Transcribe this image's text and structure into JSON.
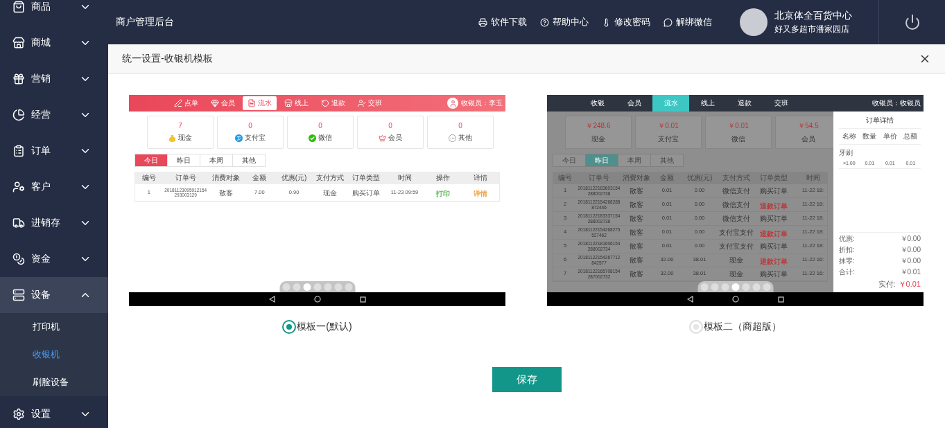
{
  "sidebar": {
    "items": [
      {
        "label": "商品",
        "expanded": false
      },
      {
        "label": "商城",
        "expanded": false
      },
      {
        "label": "营销",
        "expanded": false
      },
      {
        "label": "经营",
        "expanded": false
      },
      {
        "label": "订单",
        "expanded": false
      },
      {
        "label": "客户",
        "expanded": false
      },
      {
        "label": "进销存",
        "expanded": false
      },
      {
        "label": "资金",
        "expanded": false
      },
      {
        "label": "设备",
        "expanded": true,
        "children": [
          {
            "label": "打印机",
            "selected": false
          },
          {
            "label": "收银机",
            "selected": true
          },
          {
            "label": "刷脸设备",
            "selected": false
          }
        ]
      },
      {
        "label": "设置",
        "expanded": false
      }
    ]
  },
  "header": {
    "title": "商户管理后台",
    "links": [
      "软件下载",
      "帮助中心",
      "修改密码",
      "解绑微信"
    ],
    "user": {
      "name": "北京体全百货中心",
      "store": "好又多超市潘家园店"
    }
  },
  "modal": {
    "title": "统一设置-收银机模板",
    "templates": [
      {
        "label": "模板一(默认)",
        "selected": true,
        "preview": {
          "kind": "classic",
          "overlay": false,
          "nav": {
            "tabs": [
              {
                "label": "点单",
                "selected": false
              },
              {
                "label": "会员",
                "selected": false
              },
              {
                "label": "流水",
                "selected": true
              },
              {
                "label": "线上",
                "selected": false
              },
              {
                "label": "退款",
                "selected": false
              },
              {
                "label": "交班",
                "selected": false
              }
            ],
            "cashier": "收银员：李玉"
          },
          "stats": [
            {
              "value": "7",
              "label": "现金"
            },
            {
              "value": "0",
              "label": "支付宝"
            },
            {
              "value": "0",
              "label": "微信"
            },
            {
              "value": "0",
              "label": "会员"
            },
            {
              "value": "0",
              "label": "其他"
            }
          ],
          "filters": [
            {
              "label": "今日",
              "selected": true
            },
            {
              "label": "昨日",
              "selected": false
            },
            {
              "label": "本周",
              "selected": false
            },
            {
              "label": "其他",
              "selected": false
            }
          ],
          "table": {
            "columns": [
              "编号",
              "订单号",
              "消费对象",
              "金额",
              "优惠(元)",
              "支付方式",
              "订单类型",
              "时间",
              "操作",
              "详情"
            ],
            "rows": [
              {
                "cells": [
                  "1",
                  "20181123095912154 293003129",
                  "散客",
                  "7.00",
                  "0.90",
                  "现金",
                  "购买订单",
                  "11-23 09:59",
                  {
                    "text": "打印",
                    "color": "#5cb85c"
                  },
                  {
                    "text": "详情",
                    "color": "#f0a040"
                  }
                ]
              }
            ]
          },
          "dots": [
            {
              "selected": false
            },
            {
              "selected": false
            },
            {
              "selected": true
            },
            {
              "selected": false
            },
            {
              "selected": false
            },
            {
              "selected": false
            },
            {
              "selected": false
            }
          ]
        }
      },
      {
        "label": "模板二（商超版）",
        "selected": false,
        "preview": {
          "kind": "supermarket",
          "overlay": true,
          "nav": {
            "tabs": [
              {
                "label": "收银",
                "selected": false
              },
              {
                "label": "会员",
                "selected": false
              },
              {
                "label": "流水",
                "selected": true
              },
              {
                "label": "线上",
                "selected": false
              },
              {
                "label": "退款",
                "selected": false
              },
              {
                "label": "交班",
                "selected": false
              }
            ],
            "cashier": "收银员：收银员"
          },
          "stats": [
            {
              "value": "￥248.6",
              "label": "现金"
            },
            {
              "value": "￥0.01",
              "label": "支付宝"
            },
            {
              "value": "￥0.01",
              "label": "微信"
            },
            {
              "value": "￥54.5",
              "label": "会员"
            }
          ],
          "filters": [
            {
              "label": "今日",
              "selected": false
            },
            {
              "label": "昨日",
              "selected": true
            },
            {
              "label": "本周",
              "selected": false
            },
            {
              "label": "其他",
              "selected": false
            }
          ],
          "table": {
            "columns": [
              "编号",
              "订单号",
              "消费对象",
              "金额",
              "优惠(元)",
              "支付方式",
              "订单类型",
              "时间"
            ],
            "rows": [
              {
                "cells": [
                  "1",
                  "20181122183603154 288002738",
                  "散客",
                  "0.01",
                  "0.00",
                  "微信支付",
                  "购买订单",
                  "11-22 18:"
                ]
              },
              {
                "cells": [
                  "2",
                  "20181122154268288 872446",
                  "散客",
                  "0.01",
                  "0.00",
                  "微信支付",
                  {
                    "text": "退款订单",
                    "color": "#b83a3a"
                  },
                  "11-22 18:"
                ]
              },
              {
                "cells": [
                  "3",
                  "20181122183337154 288002736",
                  "散客",
                  "0.01",
                  "0.00",
                  "微信支付",
                  "购买订单",
                  "11-22 18:"
                ]
              },
              {
                "cells": [
                  "4",
                  "20181122154268275 527462",
                  "散客",
                  "0.01",
                  "0.00",
                  "支付宝支付",
                  {
                    "text": "退款订单",
                    "color": "#b83a3a"
                  },
                  "11-22 18:"
                ]
              },
              {
                "cells": [
                  "5",
                  "20181122181606154 288002734",
                  "散客",
                  "0.01",
                  "0.00",
                  "支付宝支付",
                  "购买订单",
                  "11-22 18:"
                ]
              },
              {
                "cells": [
                  "6",
                  "20181122154267712 842577",
                  "散客",
                  "32.00",
                  "38.01",
                  "现金",
                  {
                    "text": "退款订单",
                    "color": "#b83a3a"
                  },
                  "11-22 16:"
                ]
              },
              {
                "cells": [
                  "7",
                  "20181122165708154 287002732",
                  "散客",
                  "32.00",
                  "38.01",
                  "现金",
                  "购买订单",
                  "11-22 16:"
                ]
              }
            ]
          },
          "detail_panel": {
            "title": "订单详情",
            "columns": [
              "名称",
              "数量",
              "单价",
              "总额"
            ],
            "item": "牙刷",
            "line": [
              "×1.00",
              "0.01",
              "0.01",
              "0.01"
            ],
            "totals": [
              {
                "label": "优惠:",
                "value": "￥0.00"
              },
              {
                "label": "折扣:",
                "value": "￥0.00"
              },
              {
                "label": "抹零:",
                "value": "￥0.00"
              },
              {
                "label": "合计:",
                "value": "￥0.01"
              }
            ],
            "paid": {
              "label": "实付:",
              "value": "￥0.01"
            }
          },
          "dots": [
            {
              "selected": false
            },
            {
              "selected": false
            },
            {
              "selected": false
            },
            {
              "selected": true
            },
            {
              "selected": false
            },
            {
              "selected": false
            },
            {
              "selected": false
            }
          ]
        }
      }
    ],
    "save_button": "保存"
  }
}
